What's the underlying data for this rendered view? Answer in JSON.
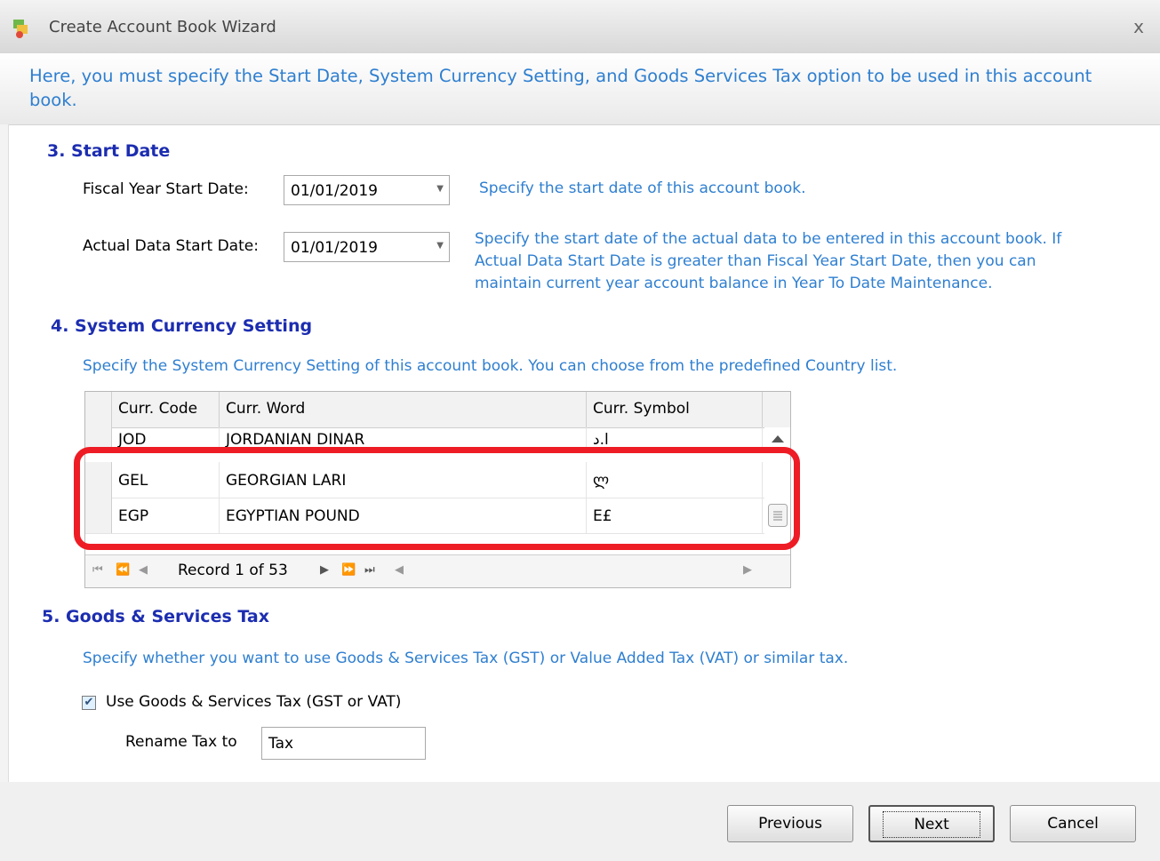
{
  "window": {
    "title": "Create Account Book Wizard",
    "close_label": "x",
    "icon": "account-book-icon"
  },
  "instructions": "Here, you must specify the Start Date, System Currency Setting, and Goods  Services Tax option to be used in this account book.",
  "start_date": {
    "heading": "3. Start Date",
    "fiscal_label": "Fiscal Year Start Date:",
    "fiscal_value": "01/01/2019",
    "fiscal_hint": "Specify the start date of this account book.",
    "actual_label": "Actual Data Start Date:",
    "actual_value": "01/01/2019",
    "actual_hint_1": "Specify the start date of the actual data to be entered in this account book. If",
    "actual_hint_2": "Actual Data Start Date is greater than Fiscal Year Start Date, then you can",
    "actual_hint_3": "maintain current year account balance in Year To Date Maintenance."
  },
  "currency": {
    "heading": "4. System Currency Setting",
    "hint": "Specify the System Currency Setting of this account book. You can choose from the predefined Country list.",
    "columns": [
      "Curr. Code",
      "Curr. Word",
      "Curr. Symbol"
    ],
    "rows": [
      {
        "code": "JOD",
        "word": "JORDANIAN DINAR",
        "symbol": "ا.د"
      },
      {
        "code": "GEL",
        "word": "GEORGIAN LARI",
        "symbol": "ლ"
      },
      {
        "code": "EGP",
        "word": "EGYPTIAN POUND",
        "symbol": "E£"
      }
    ],
    "record_text": "Record 1 of 53"
  },
  "gst": {
    "heading": "5. Goods & Services Tax",
    "hint": "Specify whether you want to use Goods & Services Tax (GST) or Value Added Tax (VAT) or similar tax.",
    "checkbox_label": "Use Goods & Services Tax (GST or VAT)",
    "checked": true,
    "rename_label": "Rename Tax to",
    "rename_value": "Tax"
  },
  "buttons": {
    "previous": "Previous",
    "next": "Next",
    "cancel": "Cancel"
  },
  "colors": {
    "heading": "#1c2db0",
    "hint": "#2f7fd0",
    "highlight": "#ee1c24"
  }
}
